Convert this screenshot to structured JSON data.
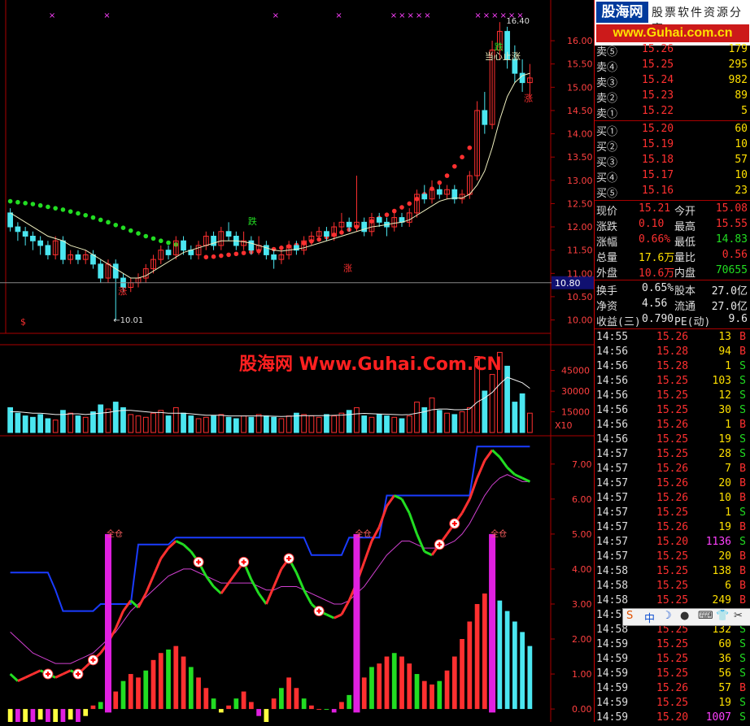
{
  "watermark": {
    "text": "股海网 Www.Guhai.Com.CN"
  },
  "brand": {
    "logo": "股海网",
    "slogan": "股票软件资源分享",
    "url": "www.Guhai.com.cn"
  },
  "colors": {
    "up": "#ff3030",
    "down": "#22dd22",
    "cyan": "#4be6f0",
    "panel_border": "#aa0000",
    "blue_line": "#1a3cff",
    "magenta": "#e020e0"
  },
  "price_panel": {
    "high_label": "16.40",
    "low_label": "←10.01",
    "mark_label": "10.80",
    "text_up": "涨",
    "text_down": "跌",
    "center_label": "当心止涨",
    "dollar": "$",
    "y_ticks": [
      "16.00",
      "15.50",
      "15.00",
      "14.50",
      "14.00",
      "13.50",
      "13.00",
      "12.50",
      "12.00",
      "11.50",
      "11.00",
      "10.50",
      "10.00"
    ]
  },
  "volume_panel": {
    "y_ticks": [
      "45000",
      "30000",
      "15000"
    ],
    "unit": "X10"
  },
  "indicator_panel": {
    "y_ticks": [
      "7.00",
      "6.00",
      "5.00",
      "4.00",
      "3.00",
      "2.00",
      "1.00",
      "0.00"
    ],
    "signal_label": "全仓"
  },
  "quotes": {
    "sells": [
      {
        "label": "卖⑤",
        "price": "15.26",
        "vol": "179"
      },
      {
        "label": "卖④",
        "price": "15.25",
        "vol": "295"
      },
      {
        "label": "卖③",
        "price": "15.24",
        "vol": "982"
      },
      {
        "label": "卖②",
        "price": "15.23",
        "vol": "89"
      },
      {
        "label": "卖①",
        "price": "15.22",
        "vol": "5"
      }
    ],
    "buys": [
      {
        "label": "买①",
        "price": "15.20",
        "vol": "60"
      },
      {
        "label": "买②",
        "price": "15.19",
        "vol": "10"
      },
      {
        "label": "买③",
        "price": "15.18",
        "vol": "57"
      },
      {
        "label": "买④",
        "price": "15.17",
        "vol": "10"
      },
      {
        "label": "买⑤",
        "price": "15.16",
        "vol": "23"
      }
    ]
  },
  "stats": [
    {
      "l1": "现价",
      "v1": "15.21",
      "l2": "今开",
      "v2": "15.08",
      "c1": "red",
      "c2": "red"
    },
    {
      "l1": "涨跌",
      "v1": "0.10",
      "l2": "最高",
      "v2": "15.55",
      "c1": "red",
      "c2": "red"
    },
    {
      "l1": "涨幅",
      "v1": "0.66%",
      "l2": "最低",
      "v2": "14.83",
      "c1": "red",
      "c2": "grn"
    },
    {
      "l1": "总量",
      "v1": "17.6万",
      "l2": "量比",
      "v2": "0.56",
      "c1": "yel",
      "c2": "red"
    },
    {
      "l1": "外盘",
      "v1": "10.6万",
      "l2": "内盘",
      "v2": "70655",
      "c1": "red",
      "c2": "grn"
    }
  ],
  "stats2": [
    {
      "l1": "换手",
      "v1": "0.65%",
      "l2": "股本",
      "v2": "27.0亿"
    },
    {
      "l1": "净资",
      "v1": "4.56",
      "l2": "流通",
      "v2": "27.0亿"
    },
    {
      "l1": "收益(三)",
      "v1": "0.790",
      "l2": "PE(动)",
      "v2": "9.6"
    }
  ],
  "ticks": [
    {
      "t": "14:55",
      "p": "15.26",
      "v": "13",
      "s": "B"
    },
    {
      "t": "14:56",
      "p": "15.28",
      "v": "94",
      "s": "B"
    },
    {
      "t": "14:56",
      "p": "15.28",
      "v": "1",
      "s": "S"
    },
    {
      "t": "14:56",
      "p": "15.25",
      "v": "103",
      "s": "S"
    },
    {
      "t": "14:56",
      "p": "15.25",
      "v": "12",
      "s": "S"
    },
    {
      "t": "14:56",
      "p": "15.25",
      "v": "30",
      "s": "S"
    },
    {
      "t": "14:56",
      "p": "15.26",
      "v": "1",
      "s": "B"
    },
    {
      "t": "14:56",
      "p": "15.25",
      "v": "19",
      "s": "S"
    },
    {
      "t": "14:57",
      "p": "15.25",
      "v": "28",
      "s": "S"
    },
    {
      "t": "14:57",
      "p": "15.26",
      "v": "7",
      "s": "B"
    },
    {
      "t": "14:57",
      "p": "15.26",
      "v": "20",
      "s": "B"
    },
    {
      "t": "14:57",
      "p": "15.26",
      "v": "10",
      "s": "B"
    },
    {
      "t": "14:57",
      "p": "15.25",
      "v": "1",
      "s": "S"
    },
    {
      "t": "14:57",
      "p": "15.26",
      "v": "19",
      "s": "B"
    },
    {
      "t": "14:57",
      "p": "15.20",
      "v": "1136",
      "s": "S"
    },
    {
      "t": "14:57",
      "p": "15.25",
      "v": "20",
      "s": "B"
    },
    {
      "t": "14:58",
      "p": "15.25",
      "v": "138",
      "s": "B"
    },
    {
      "t": "14:58",
      "p": "15.25",
      "v": "6",
      "s": "B"
    },
    {
      "t": "14:58",
      "p": "15.25",
      "v": "249",
      "s": "B"
    },
    {
      "t": "14:58",
      "p": "15.25",
      "v": "",
      "s": ""
    },
    {
      "t": "14:58",
      "p": "15.25",
      "v": "132",
      "s": "S"
    },
    {
      "t": "14:59",
      "p": "15.25",
      "v": "60",
      "s": "S"
    },
    {
      "t": "14:59",
      "p": "15.25",
      "v": "36",
      "s": "S"
    },
    {
      "t": "14:59",
      "p": "15.25",
      "v": "56",
      "s": "S"
    },
    {
      "t": "14:59",
      "p": "15.26",
      "v": "57",
      "s": "B"
    },
    {
      "t": "14:59",
      "p": "15.25",
      "v": "19",
      "s": "S"
    },
    {
      "t": "14:59",
      "p": "15.20",
      "v": "1007",
      "s": "S"
    }
  ],
  "toolbar": {
    "items": [
      "S",
      "中",
      "☽",
      "●",
      "⌨",
      "👕",
      "✂"
    ]
  },
  "chart_data": [
    {
      "type": "candlestick",
      "y_range": [
        9.8,
        16.7
      ],
      "candles": [
        [
          12.3,
          12.0,
          12.4,
          11.9
        ],
        [
          12.0,
          11.9,
          12.1,
          11.7
        ],
        [
          11.9,
          11.8,
          12.0,
          11.6
        ],
        [
          11.8,
          11.7,
          11.9,
          11.5
        ],
        [
          11.7,
          11.6,
          11.8,
          11.4
        ],
        [
          11.6,
          11.4,
          11.7,
          11.3
        ],
        [
          11.4,
          11.7,
          11.8,
          11.3
        ],
        [
          11.7,
          11.3,
          11.8,
          11.2
        ],
        [
          11.3,
          11.4,
          11.5,
          11.2
        ],
        [
          11.4,
          11.3,
          11.5,
          11.2
        ],
        [
          11.3,
          11.4,
          11.5,
          11.2
        ],
        [
          11.4,
          11.2,
          11.5,
          11.1
        ],
        [
          11.2,
          10.9,
          11.3,
          10.8
        ],
        [
          10.9,
          11.2,
          11.3,
          10.8
        ],
        [
          11.2,
          10.9,
          11.3,
          10.0
        ],
        [
          10.9,
          10.7,
          11.0,
          10.6
        ],
        [
          10.7,
          10.8,
          10.9,
          10.6
        ],
        [
          10.8,
          10.9,
          11.0,
          10.7
        ],
        [
          10.9,
          11.1,
          11.2,
          10.8
        ],
        [
          11.1,
          11.3,
          11.4,
          11.0
        ],
        [
          11.3,
          11.5,
          11.6,
          11.2
        ],
        [
          11.5,
          11.4,
          11.6,
          11.3
        ],
        [
          11.4,
          11.7,
          11.8,
          11.3
        ],
        [
          11.7,
          11.5,
          11.8,
          11.4
        ],
        [
          11.5,
          11.4,
          11.6,
          11.3
        ],
        [
          11.4,
          11.6,
          11.7,
          11.3
        ],
        [
          11.6,
          11.8,
          11.9,
          11.5
        ],
        [
          11.8,
          11.6,
          11.9,
          11.5
        ],
        [
          11.6,
          11.9,
          12.0,
          11.5
        ],
        [
          11.9,
          11.8,
          12.1,
          11.7
        ],
        [
          11.8,
          11.6,
          11.9,
          11.5
        ],
        [
          11.6,
          11.7,
          11.9,
          11.5
        ],
        [
          11.7,
          11.5,
          11.8,
          11.4
        ],
        [
          11.5,
          11.6,
          11.8,
          11.4
        ],
        [
          11.6,
          11.4,
          11.7,
          11.3
        ],
        [
          11.4,
          11.3,
          11.5,
          11.1
        ],
        [
          11.3,
          11.4,
          11.6,
          11.2
        ],
        [
          11.4,
          11.6,
          11.7,
          11.3
        ],
        [
          11.6,
          11.5,
          11.7,
          11.4
        ],
        [
          11.5,
          11.7,
          11.8,
          11.4
        ],
        [
          11.7,
          11.8,
          11.9,
          11.6
        ],
        [
          11.8,
          11.9,
          12.0,
          11.7
        ],
        [
          11.9,
          11.8,
          12.0,
          11.7
        ],
        [
          11.8,
          12.0,
          12.1,
          11.7
        ],
        [
          12.0,
          12.1,
          12.3,
          11.9
        ],
        [
          12.1,
          12.0,
          12.2,
          11.9
        ],
        [
          12.0,
          12.1,
          13.1,
          11.9
        ],
        [
          12.1,
          11.9,
          12.2,
          11.8
        ],
        [
          11.9,
          12.2,
          12.3,
          11.8
        ],
        [
          12.2,
          12.1,
          12.3,
          12.0
        ],
        [
          12.1,
          12.0,
          12.2,
          11.8
        ],
        [
          12.0,
          12.2,
          12.3,
          11.9
        ],
        [
          12.2,
          12.1,
          12.3,
          12.0
        ],
        [
          12.1,
          12.3,
          12.4,
          12.0
        ],
        [
          12.3,
          12.7,
          12.8,
          12.2
        ],
        [
          12.7,
          12.6,
          12.9,
          12.5
        ],
        [
          12.6,
          12.8,
          13.0,
          12.5
        ],
        [
          12.8,
          12.7,
          12.9,
          12.6
        ],
        [
          12.7,
          12.8,
          12.9,
          12.6
        ],
        [
          12.8,
          12.6,
          12.9,
          12.5
        ],
        [
          12.6,
          12.7,
          12.8,
          12.5
        ],
        [
          12.7,
          13.1,
          13.2,
          12.6
        ],
        [
          13.1,
          14.5,
          14.7,
          13.0
        ],
        [
          14.5,
          14.2,
          14.9,
          14.0
        ],
        [
          14.2,
          15.8,
          16.0,
          14.1
        ],
        [
          15.8,
          16.2,
          16.4,
          15.6
        ],
        [
          16.2,
          15.6,
          16.3,
          15.4
        ],
        [
          15.6,
          15.3,
          15.9,
          15.1
        ],
        [
          15.3,
          15.1,
          15.6,
          14.9
        ],
        [
          15.1,
          15.2,
          15.5,
          14.8
        ]
      ],
      "ma_line": [
        12.3,
        12.2,
        12.1,
        12.0,
        11.9,
        11.8,
        11.75,
        11.7,
        11.6,
        11.55,
        11.5,
        11.4,
        11.3,
        11.2,
        11.1,
        11.0,
        10.9,
        10.9,
        10.95,
        11.05,
        11.15,
        11.25,
        11.35,
        11.45,
        11.5,
        11.55,
        11.6,
        11.65,
        11.7,
        11.7,
        11.7,
        11.68,
        11.65,
        11.6,
        11.55,
        11.5,
        11.48,
        11.5,
        11.52,
        11.55,
        11.6,
        11.65,
        11.7,
        11.75,
        11.8,
        11.85,
        11.9,
        11.95,
        12.0,
        12.02,
        12.05,
        12.08,
        12.1,
        12.15,
        12.25,
        12.35,
        12.45,
        12.55,
        12.6,
        12.62,
        12.62,
        12.7,
        12.9,
        13.2,
        13.7,
        14.3,
        14.8,
        15.1,
        15.25,
        15.3
      ],
      "sar_green": [
        12.55,
        12.53,
        12.51,
        12.49,
        12.46,
        12.43,
        12.4,
        12.37,
        12.33,
        12.29,
        12.25,
        12.2,
        12.15,
        12.1,
        12.04,
        11.98,
        11.92,
        11.86,
        11.8,
        11.75,
        11.7,
        11.66,
        11.62
      ],
      "sar_red": [
        11.35,
        11.36,
        11.38,
        11.4,
        11.42,
        11.44,
        11.46,
        11.48,
        11.5,
        11.52,
        11.55,
        11.58,
        11.61,
        11.65,
        11.69,
        11.73,
        11.78,
        11.83,
        11.88,
        11.94,
        12.0,
        12.06,
        12.12,
        12.19,
        12.26,
        12.34,
        12.42,
        12.5,
        12.6,
        12.7,
        12.82,
        12.95,
        13.1,
        13.3,
        13.5,
        13.7
      ],
      "markers_x": [
        10,
        23,
        63,
        78,
        91,
        93,
        95,
        97,
        99,
        111,
        113,
        115,
        117,
        119,
        121
      ]
    },
    {
      "type": "bar",
      "y_range": [
        0,
        60000
      ],
      "values": [
        18000,
        14000,
        12000,
        11000,
        13000,
        10000,
        9000,
        16000,
        14000,
        12000,
        11000,
        15000,
        20000,
        17000,
        22000,
        18000,
        13000,
        12000,
        11000,
        14000,
        16000,
        12000,
        18000,
        14000,
        12000,
        10000,
        11000,
        12000,
        13000,
        11000,
        10000,
        12000,
        11000,
        13000,
        12000,
        11000,
        10000,
        12000,
        14000,
        13000,
        12000,
        11000,
        13000,
        12000,
        14000,
        16000,
        18000,
        12000,
        11000,
        13000,
        12000,
        11000,
        10000,
        12000,
        22000,
        18000,
        25000,
        16000,
        14000,
        13000,
        15000,
        18000,
        55000,
        30000,
        42000,
        58000,
        48000,
        22000,
        28000,
        14000
      ],
      "ma_line": [
        15000,
        15000,
        14500,
        14000,
        14000,
        13500,
        13000,
        13000,
        13500,
        13500,
        13000,
        13500,
        14000,
        14500,
        15500,
        16000,
        16000,
        15500,
        15000,
        14500,
        14500,
        14000,
        14000,
        14000,
        13500,
        13000,
        12500,
        12500,
        12500,
        12000,
        12000,
        12000,
        12000,
        12000,
        12000,
        11800,
        11600,
        11800,
        12000,
        12200,
        12200,
        12200,
        12300,
        12400,
        12600,
        13000,
        13500,
        13800,
        13600,
        13400,
        13200,
        13000,
        12800,
        13000,
        14000,
        15000,
        16500,
        17000,
        17000,
        16500,
        16500,
        17000,
        22000,
        25000,
        29000,
        35000,
        40000,
        38000,
        36000,
        32000
      ]
    },
    {
      "type": "line",
      "y_range": [
        -0.3,
        7.6
      ],
      "main_line": [
        1.0,
        0.8,
        0.9,
        1.0,
        1.1,
        1.0,
        0.9,
        1.0,
        1.1,
        1.0,
        1.2,
        1.4,
        1.6,
        1.9,
        2.3,
        2.8,
        3.1,
        2.9,
        3.3,
        3.8,
        4.3,
        4.6,
        4.8,
        4.7,
        4.5,
        4.2,
        3.8,
        3.5,
        3.3,
        3.6,
        3.9,
        4.2,
        3.7,
        3.3,
        3.0,
        3.5,
        4.0,
        4.3,
        3.9,
        3.4,
        3.0,
        2.8,
        2.7,
        2.6,
        2.7,
        3.1,
        3.6,
        4.2,
        4.8,
        5.2,
        5.8,
        6.1,
        6.0,
        5.6,
        5.0,
        4.5,
        4.4,
        4.7,
        5.0,
        5.3,
        5.6,
        6.0,
        6.6,
        7.1,
        7.4,
        7.2,
        6.9,
        6.7,
        6.6,
        6.5
      ],
      "blue_line": [
        3.9,
        3.9,
        3.9,
        3.9,
        3.9,
        3.9,
        3.4,
        2.8,
        2.8,
        2.8,
        2.8,
        2.8,
        3.0,
        3.0,
        3.0,
        3.0,
        3.0,
        4.7,
        4.7,
        4.7,
        4.7,
        4.7,
        4.9,
        4.9,
        4.9,
        4.9,
        4.9,
        4.9,
        4.9,
        4.9,
        4.9,
        4.9,
        4.9,
        4.9,
        4.9,
        4.9,
        4.9,
        4.9,
        4.9,
        4.9,
        4.4,
        4.4,
        4.4,
        4.4,
        4.4,
        4.9,
        4.9,
        4.9,
        4.9,
        4.9,
        6.1,
        6.1,
        6.1,
        6.1,
        6.1,
        6.1,
        6.1,
        6.1,
        6.1,
        6.1,
        6.1,
        6.1,
        7.5,
        7.5,
        7.5,
        7.5,
        7.5,
        7.5,
        7.5,
        7.5
      ],
      "pink_line": [
        2.2,
        2.0,
        1.8,
        1.6,
        1.5,
        1.4,
        1.3,
        1.3,
        1.3,
        1.4,
        1.5,
        1.6,
        1.8,
        2.0,
        2.2,
        2.5,
        2.8,
        3.0,
        3.2,
        3.4,
        3.6,
        3.8,
        3.9,
        4.0,
        4.0,
        3.9,
        3.8,
        3.7,
        3.6,
        3.6,
        3.6,
        3.6,
        3.6,
        3.5,
        3.4,
        3.4,
        3.5,
        3.5,
        3.5,
        3.4,
        3.3,
        3.2,
        3.1,
        3.0,
        3.0,
        3.1,
        3.3,
        3.5,
        3.8,
        4.1,
        4.4,
        4.6,
        4.8,
        4.8,
        4.7,
        4.6,
        4.6,
        4.6,
        4.7,
        4.8,
        5.0,
        5.3,
        5.7,
        6.1,
        6.4,
        6.6,
        6.7,
        6.6,
        6.5,
        6.5
      ],
      "hist": [
        -0.5,
        -0.6,
        -0.4,
        -0.5,
        -0.3,
        -0.4,
        -0.6,
        -0.5,
        -0.3,
        -0.4,
        -0.2,
        0.1,
        0.2,
        0.3,
        0.5,
        0.8,
        1.0,
        0.9,
        1.1,
        1.4,
        1.6,
        1.7,
        1.8,
        1.5,
        1.2,
        0.9,
        0.6,
        0.3,
        -0.1,
        0.1,
        0.3,
        0.5,
        0.2,
        -0.2,
        -0.4,
        0.3,
        0.6,
        0.9,
        0.6,
        0.3,
        0.1,
        0.0,
        0.0,
        -0.1,
        0.2,
        0.4,
        0.6,
        0.9,
        1.2,
        1.3,
        1.5,
        1.6,
        1.5,
        1.3,
        1.0,
        0.8,
        0.7,
        0.8,
        1.1,
        1.5,
        2.0,
        2.5,
        3.0,
        3.3,
        3.4,
        3.1,
        2.8,
        2.5,
        2.2,
        1.8
      ],
      "circle_idx": [
        5,
        9,
        11,
        25,
        41,
        31,
        37,
        59,
        57
      ],
      "signal_idx": [
        13,
        46,
        64
      ]
    }
  ]
}
